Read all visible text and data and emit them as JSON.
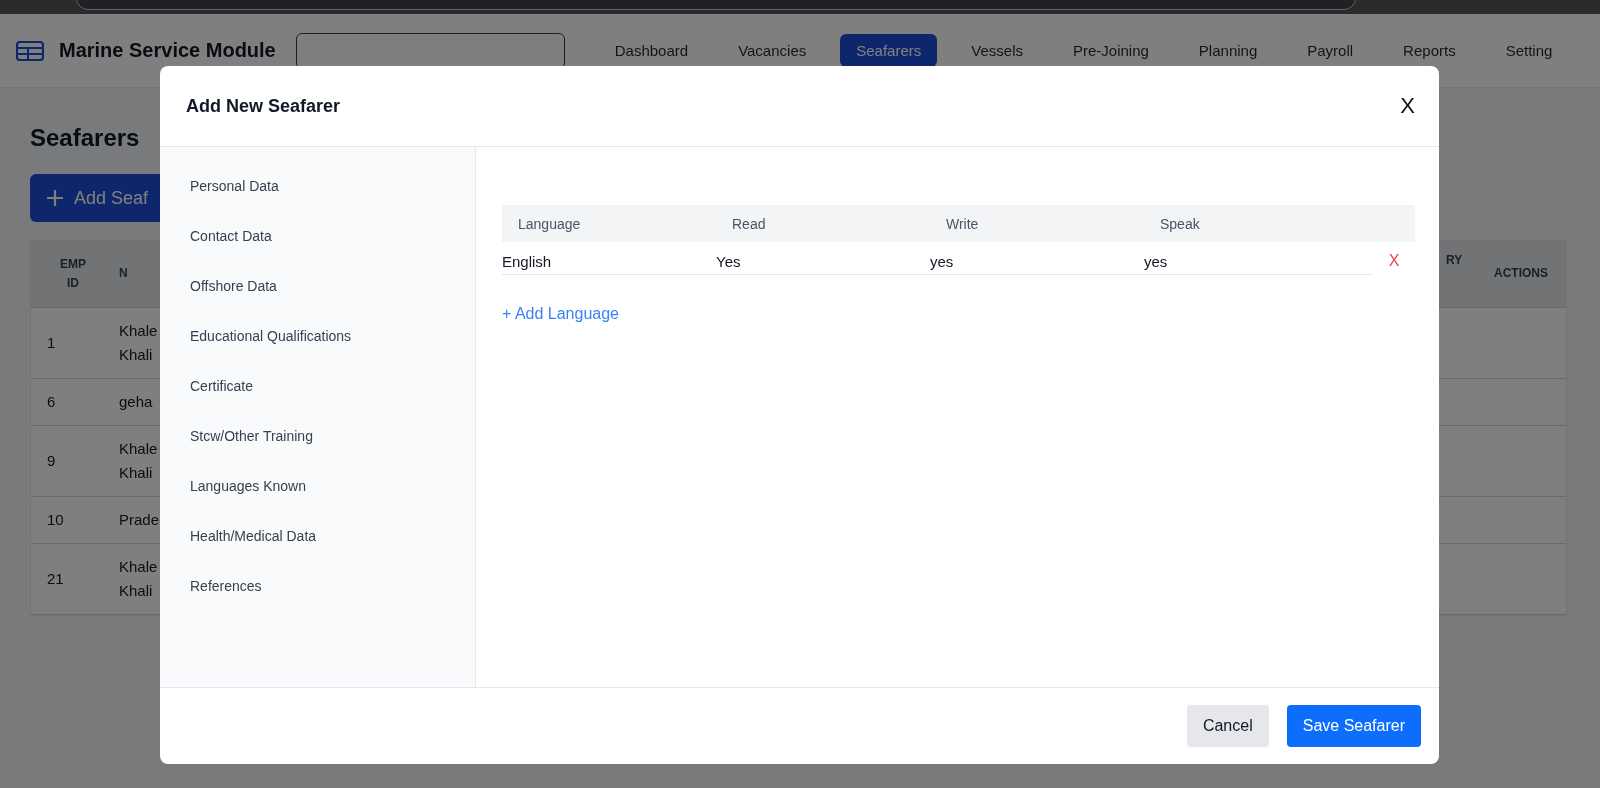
{
  "app": {
    "title": "Marine Service Module"
  },
  "nav": [
    {
      "label": "Dashboard",
      "selected": false
    },
    {
      "label": "Vacancies",
      "selected": false
    },
    {
      "label": "Seafarers",
      "selected": true
    },
    {
      "label": "Vessels",
      "selected": false
    },
    {
      "label": "Pre-Joining",
      "selected": false
    },
    {
      "label": "Planning",
      "selected": false
    },
    {
      "label": "Payroll",
      "selected": false
    },
    {
      "label": "Reports",
      "selected": false
    },
    {
      "label": "Setting",
      "selected": false
    }
  ],
  "page": {
    "title": "Seafarers",
    "add_button": "Add Seaf",
    "table": {
      "columns_left": [
        "EMP ID",
        "N"
      ],
      "columns_right": [
        "RY",
        "ACTIONS"
      ],
      "rows": [
        {
          "emp_id": "1",
          "name_lines": [
            "Khale",
            "Khali"
          ]
        },
        {
          "emp_id": "6",
          "name_lines": [
            "geha"
          ]
        },
        {
          "emp_id": "9",
          "name_lines": [
            "Khale",
            "Khali"
          ]
        },
        {
          "emp_id": "10",
          "name_lines": [
            "Prade"
          ]
        },
        {
          "emp_id": "21",
          "name_lines": [
            "Khale",
            "Khali"
          ]
        }
      ]
    }
  },
  "modal": {
    "title": "Add New Seafarer",
    "close": "X",
    "sections": [
      "Personal Data",
      "Contact Data",
      "Offshore Data",
      "Educational Qualifications",
      "Certificate",
      "Stcw/Other Training",
      "Languages Known",
      "Health/Medical Data",
      "References"
    ],
    "languages": {
      "columns": [
        "Language",
        "Read",
        "Write",
        "Speak"
      ],
      "rows": [
        {
          "cells": [
            "English",
            "Yes",
            "yes",
            "yes"
          ],
          "remove": "X"
        }
      ],
      "add_link": "+ Add Language"
    },
    "buttons": [
      {
        "label": "Cancel",
        "kind": "secondary"
      },
      {
        "label": "Save Seafarer",
        "kind": "primary"
      }
    ]
  }
}
